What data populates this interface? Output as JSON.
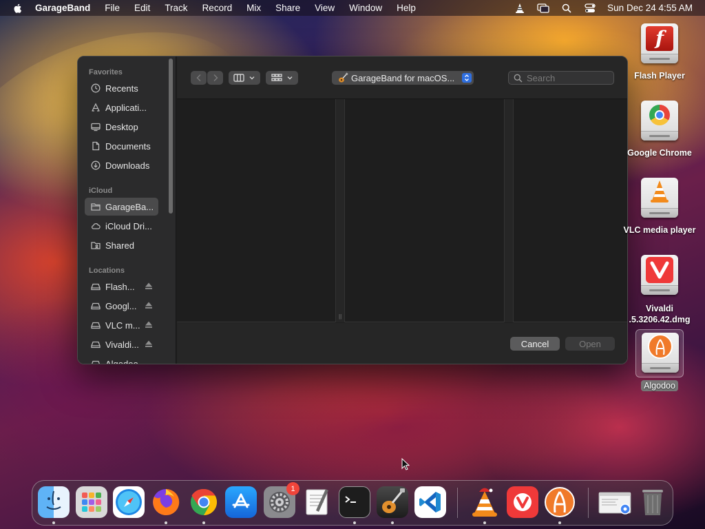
{
  "menubar": {
    "app_name": "GarageBand",
    "items": [
      "File",
      "Edit",
      "Track",
      "Record",
      "Mix",
      "Share",
      "View",
      "Window",
      "Help"
    ],
    "clock": "Sun Dec 24  4:55 AM",
    "icons": [
      "vlc-status-icon",
      "screen-mirroring-icon",
      "spotlight-search-icon",
      "control-center-icon"
    ]
  },
  "dialog": {
    "sidebar": {
      "favorites_label": "Favorites",
      "favorites": [
        {
          "label": "Recents",
          "icon": "clock-icon"
        },
        {
          "label": "Applicati...",
          "icon": "applications-icon"
        },
        {
          "label": "Desktop",
          "icon": "desktop-icon"
        },
        {
          "label": "Documents",
          "icon": "document-icon"
        },
        {
          "label": "Downloads",
          "icon": "download-icon"
        }
      ],
      "icloud_label": "iCloud",
      "icloud": [
        {
          "label": "GarageBa...",
          "icon": "folder-icon",
          "selected": true
        },
        {
          "label": "iCloud Dri...",
          "icon": "cloud-icon"
        },
        {
          "label": "Shared",
          "icon": "shared-folder-icon"
        }
      ],
      "locations_label": "Locations",
      "locations": [
        {
          "label": "Flash...",
          "icon": "drive-icon"
        },
        {
          "label": "Googl...",
          "icon": "drive-icon"
        },
        {
          "label": "VLC m...",
          "icon": "drive-icon"
        },
        {
          "label": "Vivaldi...",
          "icon": "drive-icon"
        },
        {
          "label": "Algodoo",
          "icon": "drive-icon"
        }
      ]
    },
    "toolbar": {
      "path_label": "GarageBand for macOS...",
      "search_placeholder": "Search"
    },
    "buttons": {
      "cancel": "Cancel",
      "open": "Open"
    }
  },
  "desktop_icons": [
    {
      "label": "Flash Player"
    },
    {
      "label": "Google Chrome"
    },
    {
      "label": "VLC media player"
    },
    {
      "label_line1": "Vivaldi",
      "label_line2": ".5.3206.42.dmg"
    },
    {
      "label": "Algodoo",
      "selected": true
    }
  ],
  "dock": {
    "apps": [
      "Finder",
      "Launchpad",
      "Safari",
      "Firefox",
      "Google Chrome",
      "App Store",
      "System Settings",
      "TextEdit",
      "Terminal",
      "GarageBand",
      "Visual Studio Code",
      "VLC",
      "Vivaldi",
      "Algodoo",
      "Downloads stack",
      "Trash"
    ],
    "settings_badge": "1"
  },
  "colors": {
    "accent": "#2f6fe0",
    "dialog_bg": "#1e1e1e",
    "sidebar_bg": "#2b2b2c",
    "badge": "#f0443a"
  }
}
